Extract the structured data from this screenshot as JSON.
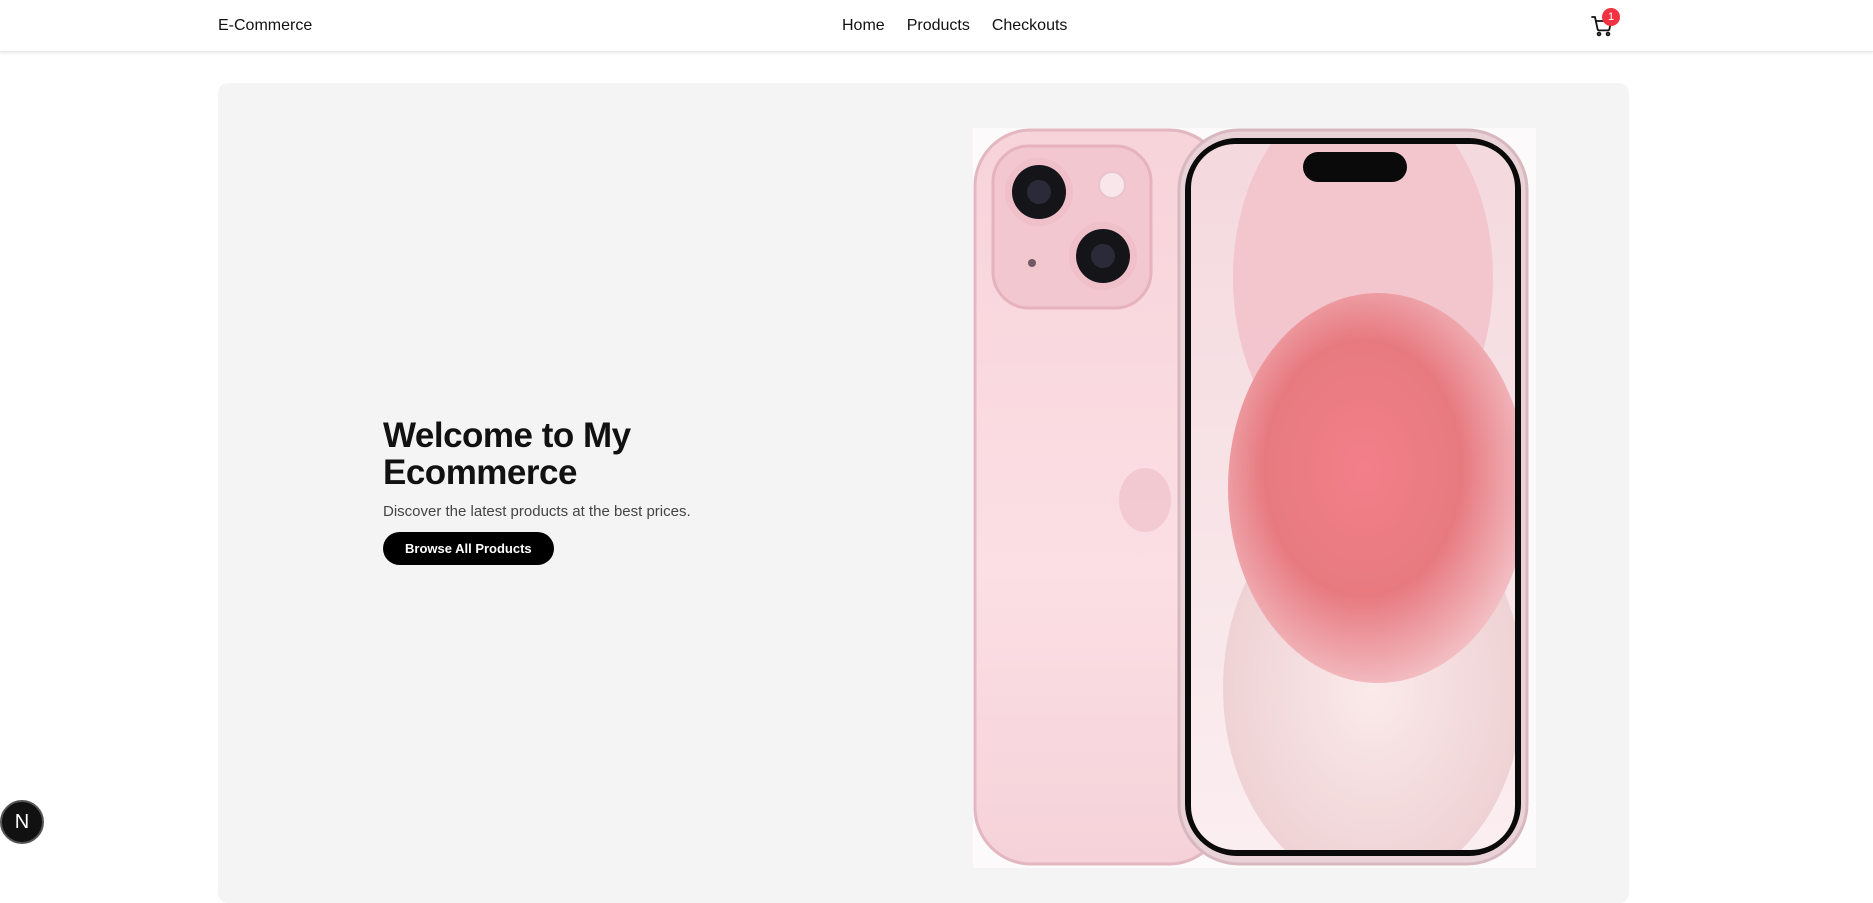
{
  "nav": {
    "brand": "E-Commerce",
    "links": [
      "Home",
      "Products",
      "Checkouts"
    ],
    "cart_count": "1"
  },
  "hero": {
    "title": "Welcome to My Ecommerce",
    "subtitle": "Discover the latest products at the best prices.",
    "cta_label": "Browse All Products",
    "image": "pink-smartphone-product-image"
  },
  "dev_badge": {
    "label": "N"
  },
  "colors": {
    "accent": "#000000",
    "badge": "#ef3340",
    "hero_bg": "#f4f4f4"
  }
}
